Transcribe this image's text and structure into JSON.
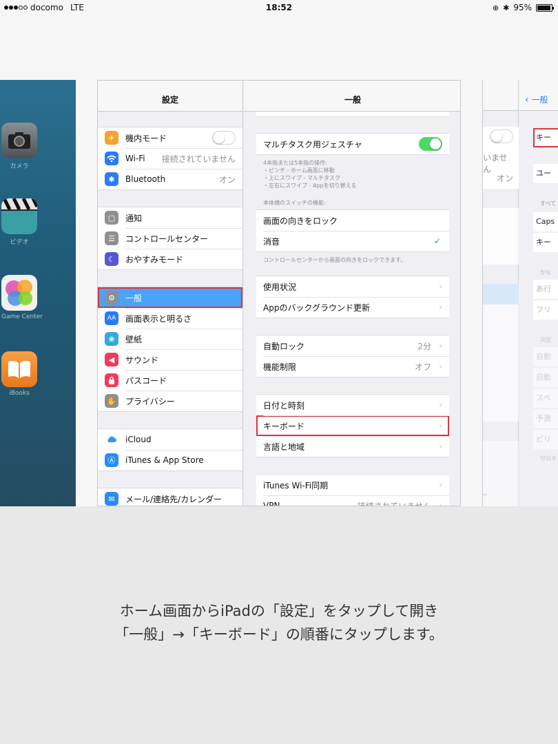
{
  "status_bar": {
    "carrier": "docomo",
    "network": "LTE",
    "time": "18:52",
    "battery": "95%",
    "battery_level": 0.95
  },
  "home_screen": {
    "apps": [
      {
        "label": "カメラ",
        "icon": "camera-icon"
      },
      {
        "label": "ビデオ",
        "icon": "video-icon"
      },
      {
        "label": "Game Center",
        "icon": "game-center-icon"
      },
      {
        "label": "iBooks",
        "icon": "ibooks-icon"
      }
    ]
  },
  "settings": {
    "sidebar_title": "設定",
    "groups": [
      [
        {
          "label": "機内モード",
          "icon": "airplane-icon",
          "color": "#f7a22b",
          "toggle": false
        },
        {
          "label": "Wi-Fi",
          "icon": "wifi-icon",
          "color": "#2a7cf6",
          "value": "接続されていません"
        },
        {
          "label": "Bluetooth",
          "icon": "bluetooth-icon",
          "color": "#2a7cf6",
          "value": "オン"
        }
      ],
      [
        {
          "label": "通知",
          "icon": "notification-icon",
          "color": "#8e8e93"
        },
        {
          "label": "コントロールセンター",
          "icon": "control-center-icon",
          "color": "#8e8e93"
        },
        {
          "label": "おやすみモード",
          "icon": "moon-icon",
          "color": "#5856d6"
        }
      ],
      [
        {
          "label": "一般",
          "icon": "gear-icon",
          "color": "#8e8e93",
          "selected": true
        },
        {
          "label": "画面表示と明るさ",
          "icon": "display-icon",
          "color": "#2a7cf6"
        },
        {
          "label": "壁紙",
          "icon": "wallpaper-icon",
          "color": "#33aadd"
        },
        {
          "label": "サウンド",
          "icon": "sound-icon",
          "color": "#f23a5a"
        },
        {
          "label": "パスコード",
          "icon": "lock-icon",
          "color": "#f23a5a"
        },
        {
          "label": "プライバシー",
          "icon": "hand-icon",
          "color": "#8e8e93"
        }
      ],
      [
        {
          "label": "iCloud",
          "icon": "icloud-icon",
          "color": "#ffffff"
        },
        {
          "label": "iTunes & App Store",
          "icon": "app-store-icon",
          "color": "#2a8cf6"
        }
      ],
      [
        {
          "label": "メール/連絡先/カレンダー",
          "icon": "mail-icon",
          "color": "#2a8cf6"
        }
      ]
    ]
  },
  "general": {
    "title": "一般",
    "multitask_label": "マルチタスク用ジェスチャ",
    "multitask_on": true,
    "multitask_notes": [
      "4本指または5本指の操作:",
      "・ピンチ - ホーム画面に移動",
      "・上にスワイプ - マルチタスク",
      "・左右にスワイプ - Appを切り替える"
    ],
    "side_switch_header": "本体横のスイッチの機能:",
    "rotation_lock": "画面の向きをロック",
    "mute": "消音",
    "switch_note": "コントロールセンターから画面の向きをロックできます。",
    "usage": "使用状況",
    "background_refresh": "Appのバックグラウンド更新",
    "auto_lock": "自動ロック",
    "auto_lock_value": "2分",
    "restrictions": "機能制限",
    "restrictions_value": "オフ",
    "date_time": "日付と時刻",
    "keyboard": "キーボード",
    "language_region": "言語と地域",
    "itunes_wifi_sync": "iTunes Wi-Fi同期",
    "vpn": "VPN",
    "vpn_value": "接続されていません"
  },
  "keyboard_screen": {
    "back_label": "一般",
    "partial_wifi_value": "いません",
    "partial_bt_value": "オン",
    "rows": [
      "キー",
      "ユー",
      "すべて",
      "Caps",
      "キー",
      "かな",
      "あ行",
      "フリ",
      "英語",
      "自動",
      "自動",
      "スペ",
      "予測",
      "ピリ",
      "空白キ",
      "ー"
    ]
  },
  "caption": "ホーム画面からiPadの「設定」をタップして開き\n「一般」→「キーボード」の順番にタップします。"
}
